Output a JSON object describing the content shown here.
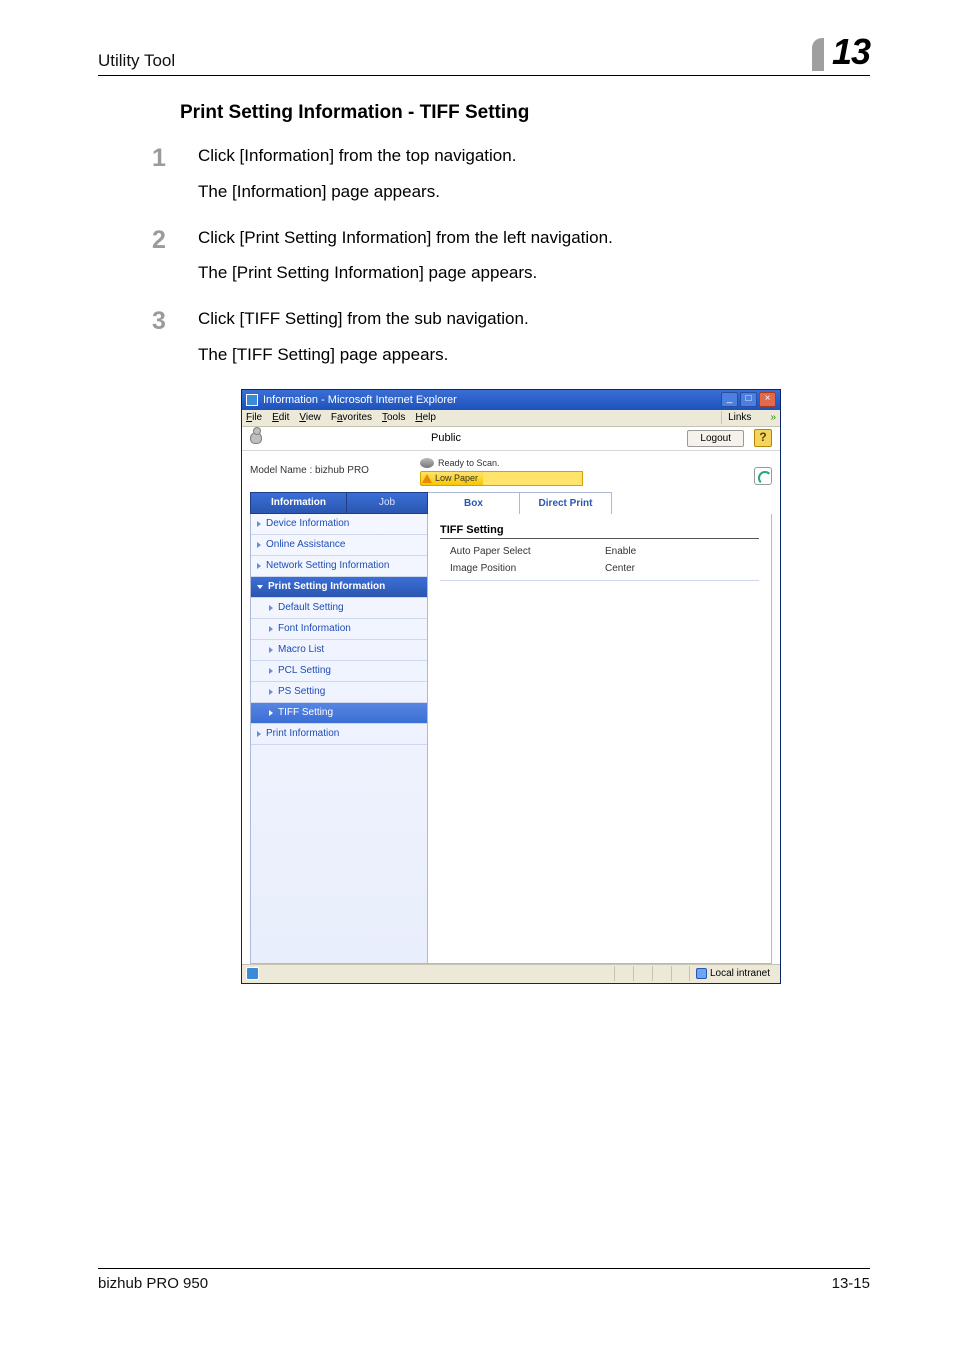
{
  "header": {
    "left": "Utility Tool",
    "chapter": "13"
  },
  "section_title": "Print Setting Information - TIFF Setting",
  "steps": [
    {
      "num": "1",
      "lines": [
        "Click [Information] from the top navigation.",
        "The [Information] page appears."
      ]
    },
    {
      "num": "2",
      "lines": [
        "Click [Print Setting Information] from the left navigation.",
        "The [Print Setting Information] page appears."
      ]
    },
    {
      "num": "3",
      "lines": [
        "Click [TIFF Setting] from the sub navigation.",
        "The [TIFF Setting] page appears."
      ]
    }
  ],
  "window": {
    "title": "Information - Microsoft Internet Explorer",
    "menu": {
      "file": "File",
      "edit": "Edit",
      "view": "View",
      "favorites": "Favorites",
      "tools": "Tools",
      "help": "Help",
      "links": "Links"
    },
    "topband": {
      "public": "Public",
      "logout": "Logout"
    },
    "model": "Model Name : bizhub PRO",
    "status": {
      "ready": "Ready to Scan.",
      "lowpaper": "Low Paper"
    },
    "maintabs": {
      "info": "Information",
      "job": "Job",
      "box": "Box",
      "dp": "Direct Print"
    },
    "sidebar": {
      "device": "Device Information",
      "online": "Online Assistance",
      "network": "Network Setting Information",
      "printset": "Print Setting Information",
      "default": "Default Setting",
      "font": "Font Information",
      "macro": "Macro List",
      "pcl": "PCL Setting",
      "ps": "PS Setting",
      "tiff": "TIFF Setting",
      "printinfo": "Print Information"
    },
    "pane": {
      "heading": "TIFF Setting",
      "rows": [
        {
          "k": "Auto Paper Select",
          "v": "Enable"
        },
        {
          "k": "Image Position",
          "v": "Center"
        }
      ]
    },
    "statusbar": {
      "zone": "Local intranet"
    }
  },
  "footer": {
    "left": "bizhub PRO 950",
    "right": "13-15"
  }
}
